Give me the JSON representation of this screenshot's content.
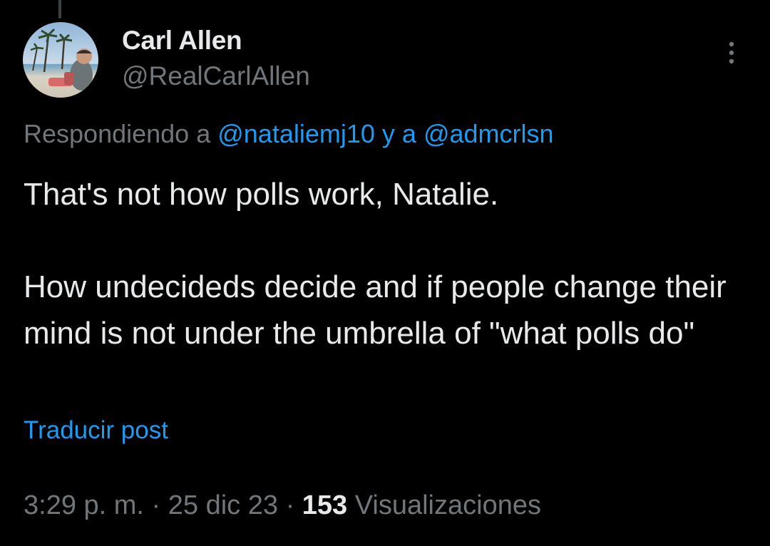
{
  "author": {
    "display_name": "Carl Allen",
    "handle": "@RealCarlAllen",
    "avatar": "profile-photo-beach"
  },
  "more_icon": "more-vertical-icon",
  "replying_to": {
    "prefix": "Respondiendo a",
    "mention_1": "@nataliemj10",
    "conjunction": "y a",
    "mention_2": "@admcrlsn"
  },
  "tweet": {
    "line_1": "That's not how polls work, Natalie.",
    "line_2": "How undecideds decide and if people change their mind is not under the umbrella of \"what polls do\""
  },
  "translate_label": "Traducir post",
  "meta": {
    "time": "3:29 p. m.",
    "separator": "·",
    "date": "25 dic 23",
    "views_count": "153",
    "views_label": "Visualizaciones"
  },
  "colors": {
    "background": "#000000",
    "text_primary": "#e7e9ea",
    "text_secondary": "#71767b",
    "link": "#1d9bf0"
  }
}
